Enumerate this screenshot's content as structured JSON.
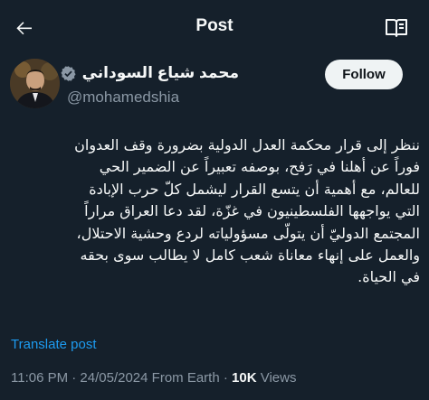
{
  "header": {
    "title": "Post",
    "back_icon": "arrow-left-icon",
    "reader_icon": "reader-book-icon"
  },
  "author": {
    "display_name": "محمد شياع السوداني",
    "handle": "@mohamedshia",
    "verified_icon": "verified-badge-icon",
    "verified_color": "#8b98a5",
    "follow_label": "Follow"
  },
  "tweet": {
    "lines": [
      "ننظر إلى قرار محكمة العدل الدولية بضرورة وقف العدوان",
      "فوراً عن أهلنا في رَفح، بوصفه تعبيراً عن الضمير الحي",
      "للعالم، مع أهمية أن يتسع القرار ليشمل كلّ حرب الإبادة",
      "التي يواجهها الفلسطينيون في غزّة، لقد دعا العراق مراراً",
      "المجتمع الدوليّ أن يتولّى مسؤولياته لردع وحشية الاحتلال،",
      "والعمل على إنهاء معاناة شعب كامل لا يطالب سوى بحقه",
      "في الحياة."
    ]
  },
  "translate_label": "Translate post",
  "meta": {
    "prefix": "11:06 PM · 24/05/2024 From Earth · ",
    "views_count": "10K",
    "views_label": " Views"
  },
  "colors": {
    "background": "#15202b",
    "text": "#f7f9f9",
    "secondary": "#8b98a5",
    "link": "#1d9bf0",
    "follow_bg": "#eff3f4"
  }
}
